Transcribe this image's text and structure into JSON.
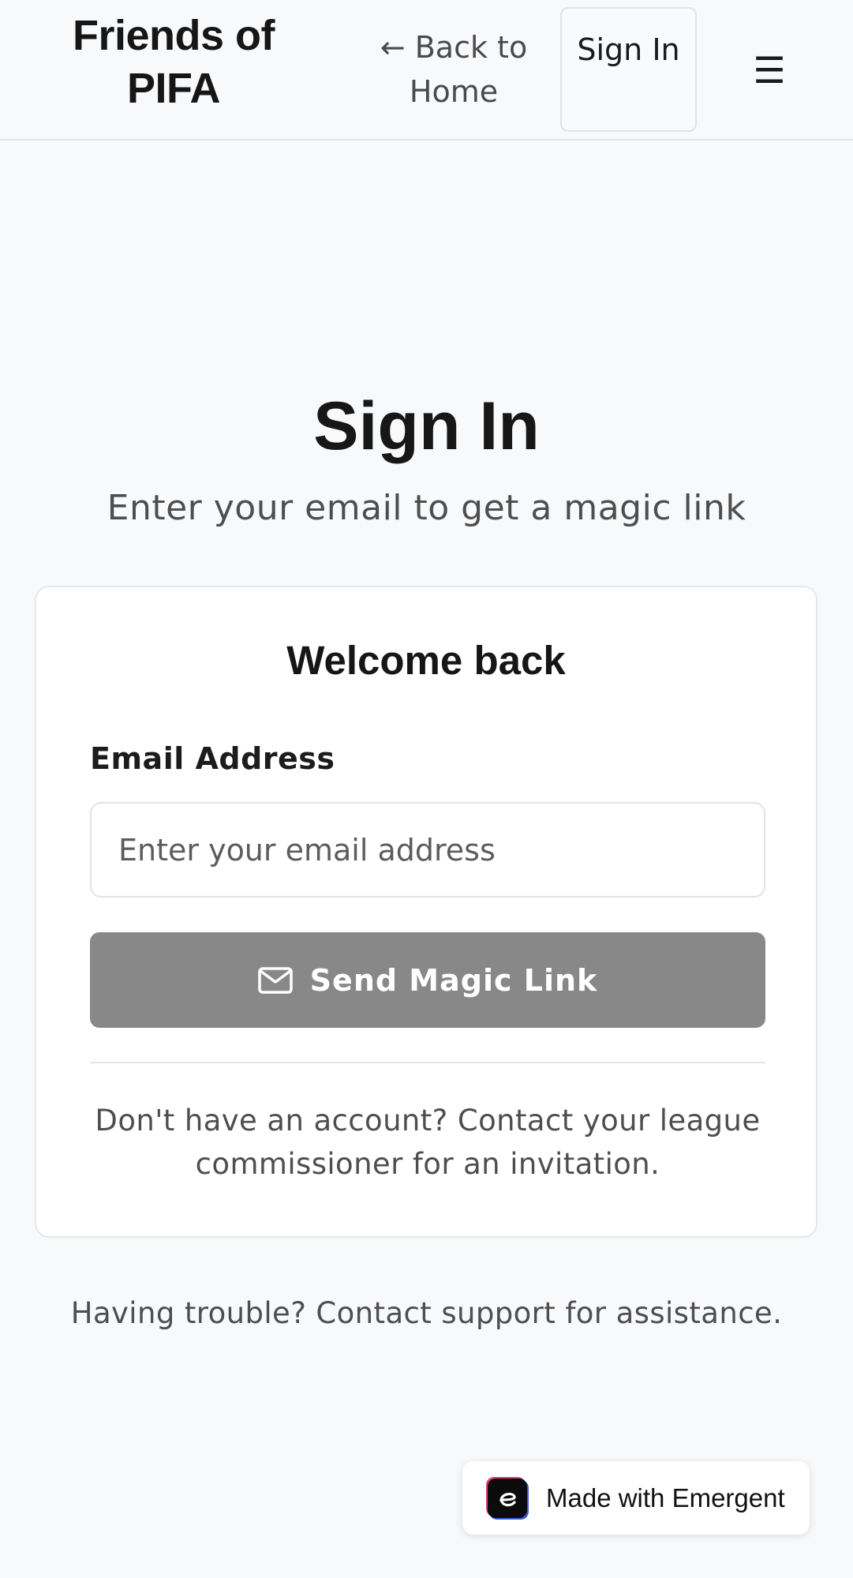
{
  "header": {
    "brand": "Friends of PIFA",
    "back_link": "← Back to Home",
    "signin_label": "Sign In",
    "menu_icon": "☰"
  },
  "hero": {
    "title": "Sign In",
    "subtitle": "Enter your email to get a magic link"
  },
  "card": {
    "title": "Welcome back",
    "email_label": "Email Address",
    "email_placeholder": "Enter your email address",
    "email_value": "",
    "send_button_label": "Send Magic Link",
    "send_button_icon": "mail-icon",
    "note": "Don't have an account? Contact your league commissioner for an invitation."
  },
  "footer": {
    "trouble_text": "Having trouble? Contact support for assistance."
  },
  "badge": {
    "label": "Made with Emergent",
    "icon": "emergent-logo-icon"
  },
  "colors": {
    "background": "#f8f9fb",
    "button_disabled": "#888888",
    "text_primary": "#161616",
    "text_muted": "#4e4e4e"
  }
}
